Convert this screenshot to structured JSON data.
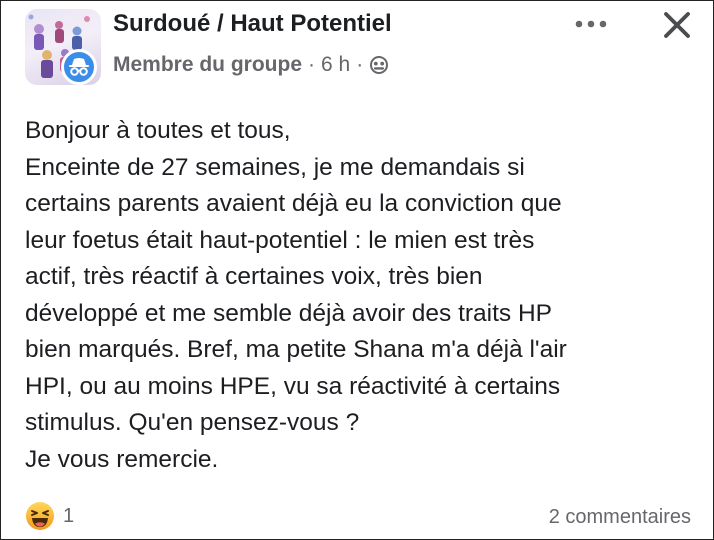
{
  "post": {
    "group_name": "Surdoué / Haut Potentiel",
    "author_role": "Membre du groupe",
    "separator": "·",
    "time": "6 h",
    "audience_icon": "group-audience-icon",
    "body_lines": [
      "Bonjour à toutes et tous,",
      "Enceinte de 27 semaines, je me demandais si",
      "certains parents avaient déjà eu la conviction que",
      "leur foetus était haut-potentiel : le mien est très",
      "actif, très réactif à certaines voix, très bien",
      "développé et me semble déjà avoir des traits HP",
      "bien marqués. Bref, ma petite Shana m'a déjà l'air",
      "HPI, ou au moins HPE, vu sa réactivité à certains",
      "stimulus. Qu'en pensez-vous ?",
      "Je vous remercie."
    ],
    "reaction_icon": "haha-reaction-icon",
    "reaction_count": "1",
    "comments": "2 commentaires"
  },
  "colors": {
    "text": "#1c1e21",
    "secondary": "#65676b",
    "anonymous_badge": "#3b8ee8",
    "reaction": "#f7b125"
  }
}
